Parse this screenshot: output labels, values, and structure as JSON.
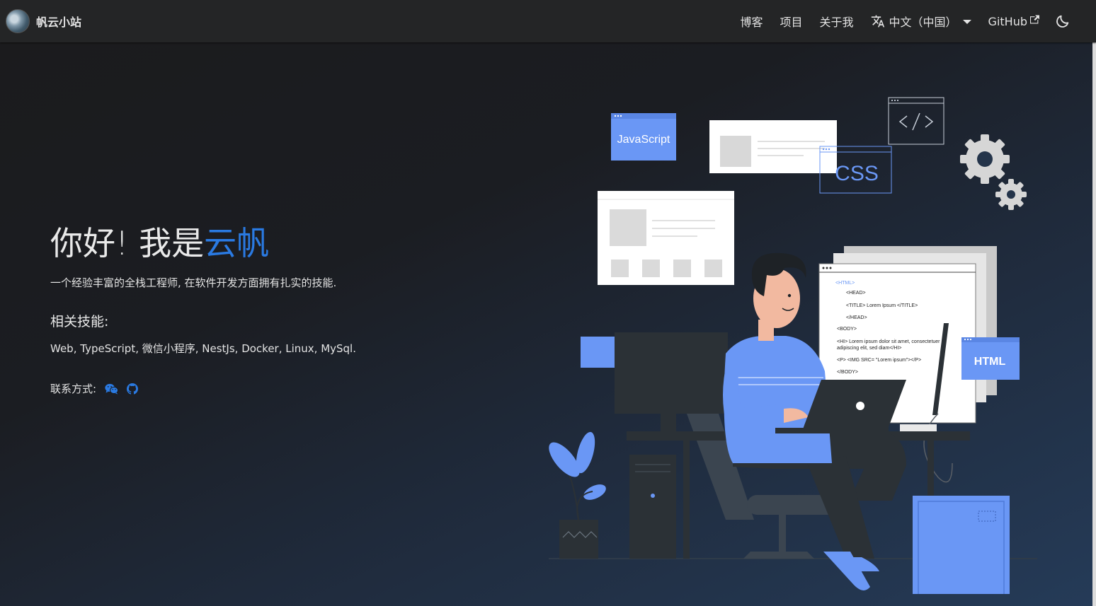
{
  "nav": {
    "brand": "帆云小站",
    "links": [
      "博客",
      "项目",
      "关于我"
    ],
    "language": "中文（中国）",
    "github": "GitHub"
  },
  "hero": {
    "greeting": "你好! 我是",
    "name": "云帆",
    "subtitle": "一个经验丰富的全栈工程师, 在软件开发方面拥有扎实的技能.",
    "skills_title": "相关技能:",
    "skills": "Web, TypeScript, 微信小程序, NestJs, Docker, Linux, MySql.",
    "contact_label": "联系方式:"
  },
  "illustration": {
    "card_javascript": "JavaScript",
    "card_css": "CSS",
    "card_html": "HTML",
    "code_lines": [
      "<HTML>",
      "<HEAD>",
      "<TITLE> Lorem Ipsum </TITLE>",
      "</HEAD>",
      "<BODY>",
      "<HI> Lorem ipsum dolor sit amet, consectetuer",
      "adipiscing elit, sed diam</HI>",
      "<P> <IMG SRC= \"Lorem ipsum\"></P>",
      "</BODY>"
    ]
  },
  "colors": {
    "accent": "#2a7ae2",
    "illustration_blue": "#6a97f5",
    "navbar_bg": "#242526",
    "page_bg": "#1b1b1d"
  },
  "icons": [
    "language-icon",
    "external-link-icon",
    "moon-icon",
    "wechat-icon",
    "github-icon"
  ]
}
